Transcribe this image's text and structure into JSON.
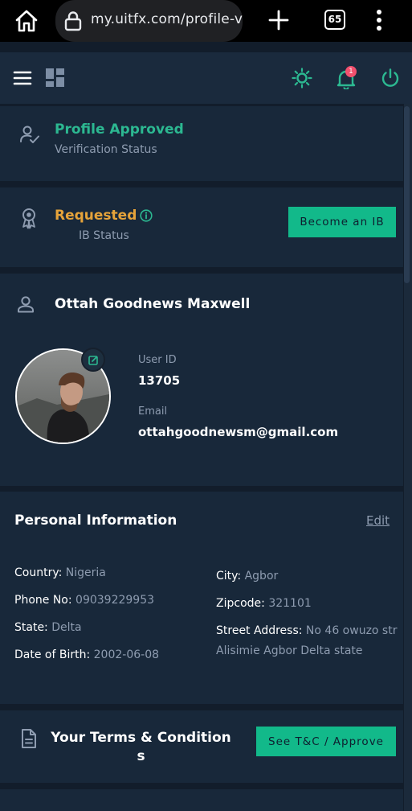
{
  "browser": {
    "url": "my.uitfx.com/profile-v",
    "tab_count": "65",
    "icons": [
      "home-icon",
      "lock-icon",
      "plus-icon",
      "tabs-icon",
      "more-vert-icon"
    ]
  },
  "header": {
    "icons": [
      "menu-icon",
      "dashboard-icon",
      "theme-icon",
      "bell-icon",
      "power-icon"
    ],
    "notification_count": "1",
    "accent": "#2cb891"
  },
  "verification": {
    "title": "Profile Approved",
    "subtitle": "Verification Status"
  },
  "ib": {
    "title": "Requested",
    "subtitle": "IB Status",
    "button_label": "Become an IB"
  },
  "profile": {
    "name": "Ottah Goodnews Maxwell",
    "user_id_label": "User ID",
    "user_id": "13705",
    "email_label": "Email",
    "email": "ottahgoodnewsm@gmail.com"
  },
  "personal": {
    "title": "Personal Information",
    "edit_label": "Edit",
    "left": [
      {
        "key": "Country:",
        "value": "Nigeria"
      },
      {
        "key": "Phone No:",
        "value": "09039229953"
      },
      {
        "key": "State:",
        "value": "Delta"
      },
      {
        "key": "Date of Birth:",
        "value": "2002-06-08"
      }
    ],
    "right": [
      {
        "key": "City:",
        "value": "Agbor"
      },
      {
        "key": "Zipcode:",
        "value": "321101"
      },
      {
        "key": "Street Address:",
        "value": "No 46 owuzo str"
      }
    ],
    "street_address_line2": "Alisimie Agbor Delta state"
  },
  "terms": {
    "title_line1": "Your Terms & Condition",
    "title_line2": "s",
    "button_label": "See T&C / Approve"
  },
  "colors": {
    "background": "#121d2b",
    "card": "#18283a",
    "green": "#2cb891",
    "orange": "#e5a33a",
    "button": "#12b98a"
  }
}
